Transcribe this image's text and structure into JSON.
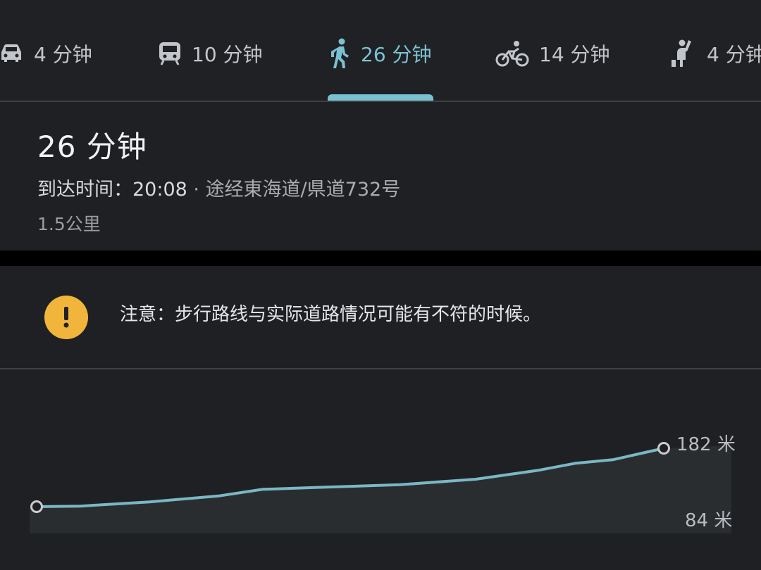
{
  "tabs": [
    {
      "mode": "car",
      "icon": "car-icon",
      "label": "4 分钟",
      "active": false
    },
    {
      "mode": "transit",
      "icon": "train-icon",
      "label": "10 分钟",
      "active": false
    },
    {
      "mode": "walk",
      "icon": "walking-person-icon",
      "label": "26 分钟",
      "active": true
    },
    {
      "mode": "bike",
      "icon": "bicycle-icon",
      "label": "14 分钟",
      "active": false
    },
    {
      "mode": "ride",
      "icon": "hail-ride-icon",
      "label": "4 分钟",
      "active": false
    }
  ],
  "summary": {
    "duration": "26 分钟",
    "arrival_prefix": "到达时间：",
    "arrival_time": "20:08",
    "via": "途经東海道/県道732号",
    "distance": "1.5公里"
  },
  "notice": {
    "icon": "warning-icon",
    "text": "注意：步行路线与实际道路情况可能有不符的时候。"
  },
  "elevation": {
    "max_label": "182 米",
    "min_label": "84 米",
    "chart_data": {
      "type": "area",
      "x": [
        0,
        0.07,
        0.18,
        0.29,
        0.36,
        0.44,
        0.58,
        0.7,
        0.8,
        0.86,
        0.92,
        1.0
      ],
      "values": [
        84,
        85,
        92,
        102,
        113,
        116,
        121,
        130,
        145,
        157,
        163,
        182
      ],
      "ylim": [
        84,
        182
      ],
      "line_color": "#7ab7c6",
      "area_color": "#2a2d2f"
    }
  },
  "colors": {
    "accent": "#7bc2d3",
    "warning": "#f2b53c"
  }
}
